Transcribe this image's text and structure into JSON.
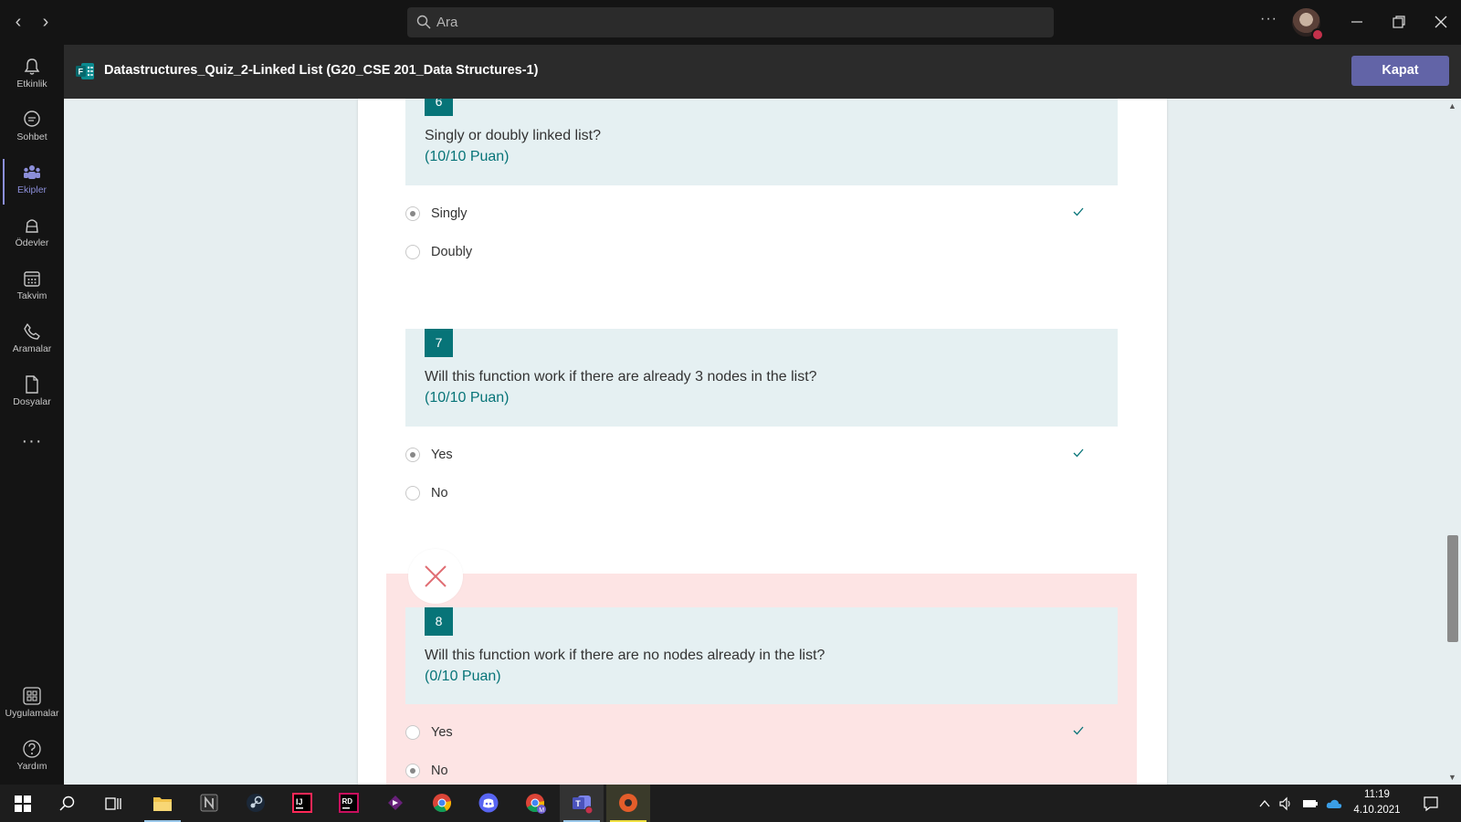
{
  "titlebar": {
    "search_placeholder": "Ara",
    "more_label": "···"
  },
  "rail": {
    "items": [
      {
        "label": "Etkinlik",
        "icon": "bell-icon"
      },
      {
        "label": "Sohbet",
        "icon": "chat-icon"
      },
      {
        "label": "Ekipler",
        "icon": "teams-icon",
        "active": true
      },
      {
        "label": "Ödevler",
        "icon": "assignments-icon"
      },
      {
        "label": "Takvim",
        "icon": "calendar-icon"
      },
      {
        "label": "Aramalar",
        "icon": "phone-icon"
      },
      {
        "label": "Dosyalar",
        "icon": "file-icon"
      }
    ],
    "more": "···",
    "bottom": [
      {
        "label": "Uygulamalar",
        "icon": "apps-icon"
      },
      {
        "label": "Yardım",
        "icon": "help-icon"
      }
    ]
  },
  "header": {
    "title": "Datastructures_Quiz_2-Linked List (G20_CSE 201_Data Structures-1)",
    "close_label": "Kapat"
  },
  "questions": [
    {
      "number": "6",
      "text": "Singly or doubly linked list?",
      "points": "(10/10 Puan)",
      "options": [
        {
          "label": "Singly",
          "selected": true,
          "correct": true
        },
        {
          "label": "Doubly",
          "selected": false,
          "correct": false
        }
      ]
    },
    {
      "number": "7",
      "text": "Will this function work if there are already 3 nodes in the list?",
      "points": "(10/10 Puan)",
      "options": [
        {
          "label": "Yes",
          "selected": true,
          "correct": true
        },
        {
          "label": "No",
          "selected": false,
          "correct": false
        }
      ]
    },
    {
      "number": "8",
      "text": "Will this function work if there are no nodes already in the list?",
      "points": "(0/10 Puan)",
      "wrong": true,
      "options": [
        {
          "label": "Yes",
          "selected": false,
          "correct": true
        },
        {
          "label": "No",
          "selected": true,
          "correct": false
        }
      ]
    }
  ],
  "taskbar": {
    "time": "11:19",
    "date": "4.10.2021",
    "apps": [
      "windows-start-icon",
      "search-icon",
      "task-view-icon",
      "file-explorer-icon",
      "notion-icon",
      "steam-icon",
      "intellij-icon",
      "rider-icon",
      "visual-studio-icon",
      "chrome-icon",
      "discord-icon",
      "chrome-profile-icon",
      "teams-icon",
      "media-player-icon"
    ]
  },
  "colors": {
    "accent": "#6264a7",
    "teal": "#077478",
    "wrong_bg": "#fde4e4",
    "question_bg": "#e5f0f2"
  }
}
